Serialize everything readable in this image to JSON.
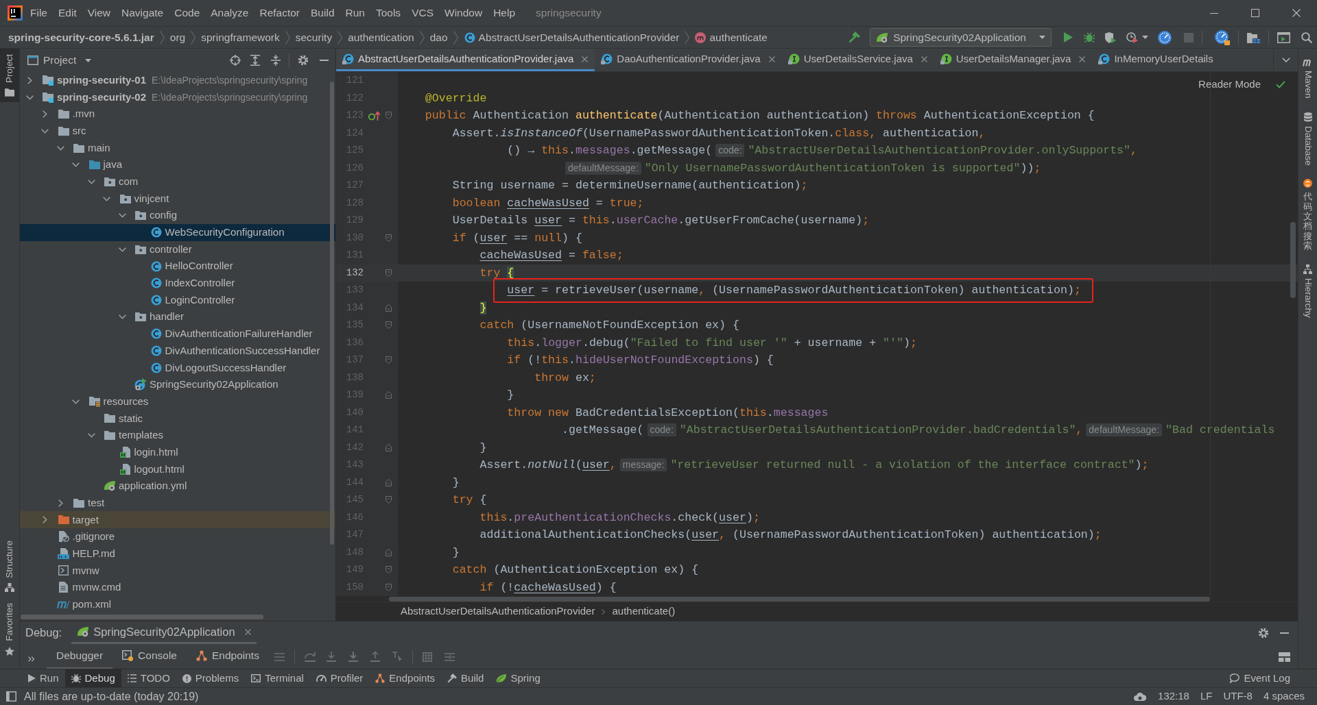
{
  "title_bar": {
    "menus": [
      "File",
      "Edit",
      "View",
      "Navigate",
      "Code",
      "Analyze",
      "Refactor",
      "Build",
      "Run",
      "Tools",
      "VCS",
      "Window",
      "Help"
    ],
    "title": "springsecurity"
  },
  "nav_bar": {
    "breadcrumbs": [
      {
        "label": "spring-security-core-5.6.1.jar",
        "kind": "jar"
      },
      {
        "label": "org",
        "kind": "package"
      },
      {
        "label": "springframework",
        "kind": "package"
      },
      {
        "label": "security",
        "kind": "package"
      },
      {
        "label": "authentication",
        "kind": "package"
      },
      {
        "label": "dao",
        "kind": "package"
      },
      {
        "label": "AbstractUserDetailsAuthenticationProvider",
        "kind": "class"
      },
      {
        "label": "authenticate",
        "kind": "method"
      }
    ],
    "run_configuration": "SpringSecurity02Application"
  },
  "left_strip": {
    "top": [
      {
        "label": "Project",
        "kind": "project",
        "selected": true
      }
    ],
    "bottom": [
      {
        "label": "Structure",
        "kind": "structure",
        "selected": false
      },
      {
        "label": "Favorites",
        "kind": "favorites",
        "selected": false
      }
    ]
  },
  "project_panel": {
    "title": "Project",
    "tree": [
      {
        "label": "spring-security-01",
        "path": "E:\\IdeaProjects\\springsecurity\\spring",
        "kind": "module",
        "expanded": false,
        "selected": false
      },
      {
        "label": "spring-security-02",
        "path": "E:\\IdeaProjects\\springsecurity\\spring",
        "kind": "module",
        "expanded": true,
        "selected": false,
        "children": [
          {
            "label": ".mvn",
            "kind": "folder",
            "expanded": false,
            "selected": false
          },
          {
            "label": "src",
            "kind": "folder",
            "expanded": true,
            "selected": false,
            "children": [
              {
                "label": "main",
                "kind": "folder",
                "expanded": true,
                "selected": false,
                "children": [
                  {
                    "label": "java",
                    "kind": "source_folder",
                    "expanded": true,
                    "selected": false,
                    "children": [
                      {
                        "label": "com",
                        "kind": "package",
                        "expanded": true,
                        "selected": false,
                        "children": [
                          {
                            "label": "vinjcent",
                            "kind": "package",
                            "expanded": true,
                            "selected": false,
                            "children": [
                              {
                                "label": "config",
                                "kind": "package",
                                "expanded": true,
                                "selected": false,
                                "children": [
                                  {
                                    "label": "WebSecurityConfiguration",
                                    "kind": "class",
                                    "selected": true
                                  }
                                ]
                              },
                              {
                                "label": "controller",
                                "kind": "package",
                                "expanded": true,
                                "selected": false,
                                "children": [
                                  {
                                    "label": "HelloController",
                                    "kind": "class",
                                    "selected": false
                                  },
                                  {
                                    "label": "IndexController",
                                    "kind": "class",
                                    "selected": false
                                  },
                                  {
                                    "label": "LoginController",
                                    "kind": "class",
                                    "selected": false
                                  }
                                ]
                              },
                              {
                                "label": "handler",
                                "kind": "package",
                                "expanded": true,
                                "selected": false,
                                "children": [
                                  {
                                    "label": "DivAuthenticationFailureHandler",
                                    "kind": "class",
                                    "selected": false
                                  },
                                  {
                                    "label": "DivAuthenticationSuccessHandler",
                                    "kind": "class",
                                    "selected": false
                                  },
                                  {
                                    "label": "DivLogoutSuccessHandler",
                                    "kind": "class",
                                    "selected": false
                                  }
                                ]
                              },
                              {
                                "label": "SpringSecurity02Application",
                                "kind": "boot_class",
                                "selected": false
                              }
                            ]
                          }
                        ]
                      }
                    ]
                  },
                  {
                    "label": "resources",
                    "kind": "resources_folder",
                    "expanded": true,
                    "selected": false,
                    "children": [
                      {
                        "label": "static",
                        "kind": "folder",
                        "selected": false
                      },
                      {
                        "label": "templates",
                        "kind": "folder",
                        "expanded": true,
                        "selected": false,
                        "children": [
                          {
                            "label": "login.html",
                            "kind": "html",
                            "selected": false
                          },
                          {
                            "label": "logout.html",
                            "kind": "html",
                            "selected": false
                          }
                        ]
                      },
                      {
                        "label": "application.yml",
                        "kind": "yaml",
                        "selected": false
                      }
                    ]
                  }
                ]
              },
              {
                "label": "test",
                "kind": "folder",
                "expanded": false,
                "selected": false
              }
            ]
          },
          {
            "label": "target",
            "kind": "excluded_folder",
            "expanded": false,
            "selected": false
          },
          {
            "label": ".gitignore",
            "kind": "ignore_file",
            "selected": false
          },
          {
            "label": "HELP.md",
            "kind": "markdown",
            "selected": false
          },
          {
            "label": "mvnw",
            "kind": "script",
            "selected": false
          },
          {
            "label": "mvnw.cmd",
            "kind": "text_file",
            "selected": false
          },
          {
            "label": "pom.xml",
            "kind": "maven",
            "selected": false
          }
        ]
      }
    ]
  },
  "editor": {
    "tabs": [
      {
        "label": "AbstractUserDetailsAuthenticationProvider.java",
        "kind": "class",
        "selected": true,
        "closable": true
      },
      {
        "label": "DaoAuthenticationProvider.java",
        "kind": "class",
        "selected": false,
        "closable": true
      },
      {
        "label": "UserDetailsService.java",
        "kind": "interface",
        "selected": false,
        "closable": true
      },
      {
        "label": "UserDetailsManager.java",
        "kind": "interface",
        "selected": false,
        "closable": true
      },
      {
        "label": "InMemoryUserDetails",
        "kind": "class",
        "selected": false,
        "closable": false
      }
    ],
    "reader_mode": "Reader Mode",
    "lines": [
      {
        "number": "121",
        "current": false,
        "boxed": false,
        "overrides": false,
        "fold_open": false,
        "fold_close": false
      },
      {
        "number": "122",
        "current": false,
        "boxed": false,
        "overrides": false,
        "fold_open": false,
        "fold_close": false,
        "tokens": [
          {
            "kind": "annotation",
            "text": "    @Override"
          }
        ]
      },
      {
        "number": "123",
        "current": false,
        "boxed": false,
        "overrides": true,
        "fold_open": true,
        "fold_close": false,
        "tokens": [
          {
            "kind": "keyword",
            "text": "    public "
          },
          {
            "kind": "plain",
            "text": "Authentication "
          },
          {
            "kind": "declaration",
            "text": "authenticate"
          },
          {
            "kind": "plain",
            "text": "(Authentication authentication) "
          },
          {
            "kind": "keyword",
            "text": "throws "
          },
          {
            "kind": "plain",
            "text": "AuthenticationException {"
          }
        ]
      },
      {
        "number": "124",
        "current": false,
        "boxed": false,
        "overrides": false,
        "fold_open": false,
        "fold_close": false,
        "tokens": [
          {
            "kind": "plain",
            "text": "        Assert."
          },
          {
            "kind": "static",
            "text": "isInstanceOf"
          },
          {
            "kind": "plain",
            "text": "(UsernamePasswordAuthenticationToken."
          },
          {
            "kind": "keyword",
            "text": "class,"
          },
          {
            "kind": "plain",
            "text": " authentication"
          },
          {
            "kind": "keyword",
            "text": ","
          }
        ]
      },
      {
        "number": "125",
        "current": false,
        "boxed": false,
        "overrides": false,
        "fold_open": false,
        "fold_close": false,
        "tokens": [
          {
            "kind": "plain",
            "text": "                () → "
          },
          {
            "kind": "keyword",
            "text": "this"
          },
          {
            "kind": "plain",
            "text": "."
          },
          {
            "kind": "field",
            "text": "messages"
          },
          {
            "kind": "plain",
            "text": ".getMessage("
          },
          {
            "kind": "hint",
            "text": "code:"
          },
          {
            "kind": "string",
            "text": "\"AbstractUserDetailsAuthenticationProvider.onlySupports\""
          },
          {
            "kind": "keyword",
            "text": ","
          }
        ]
      },
      {
        "number": "126",
        "current": false,
        "boxed": false,
        "overrides": false,
        "fold_open": false,
        "fold_close": false,
        "tokens": [
          {
            "kind": "hint",
            "text": "                        defaultMessage:"
          },
          {
            "kind": "string",
            "text": "\"Only UsernamePasswordAuthenticationToken is supported\""
          },
          {
            "kind": "plain",
            "text": "))"
          },
          {
            "kind": "keyword",
            "text": ";"
          }
        ]
      },
      {
        "number": "127",
        "current": false,
        "boxed": false,
        "overrides": false,
        "fold_open": false,
        "fold_close": false,
        "tokens": [
          {
            "kind": "plain",
            "text": "        String username = determineUsername(authentication)"
          },
          {
            "kind": "keyword",
            "text": ";"
          }
        ]
      },
      {
        "number": "128",
        "current": false,
        "boxed": false,
        "overrides": false,
        "fold_open": false,
        "fold_close": false,
        "tokens": [
          {
            "kind": "keyword",
            "text": "        boolean "
          },
          {
            "kind": "reassigned",
            "text": "cacheWasUsed"
          },
          {
            "kind": "plain",
            "text": " = "
          },
          {
            "kind": "keyword",
            "text": "true;"
          }
        ]
      },
      {
        "number": "129",
        "current": false,
        "boxed": false,
        "overrides": false,
        "fold_open": false,
        "fold_close": false,
        "tokens": [
          {
            "kind": "plain",
            "text": "        UserDetails "
          },
          {
            "kind": "reassigned",
            "text": "user"
          },
          {
            "kind": "plain",
            "text": " = "
          },
          {
            "kind": "keyword",
            "text": "this"
          },
          {
            "kind": "plain",
            "text": "."
          },
          {
            "kind": "field",
            "text": "userCache"
          },
          {
            "kind": "plain",
            "text": ".getUserFromCache(username)"
          },
          {
            "kind": "keyword",
            "text": ";"
          }
        ]
      },
      {
        "number": "130",
        "current": false,
        "boxed": false,
        "overrides": false,
        "fold_open": true,
        "fold_close": false,
        "tokens": [
          {
            "kind": "keyword",
            "text": "        if "
          },
          {
            "kind": "plain",
            "text": "("
          },
          {
            "kind": "reassigned",
            "text": "user"
          },
          {
            "kind": "plain",
            "text": " == "
          },
          {
            "kind": "keyword",
            "text": "null"
          },
          {
            "kind": "plain",
            "text": ") {"
          }
        ]
      },
      {
        "number": "131",
        "current": false,
        "boxed": false,
        "overrides": false,
        "fold_open": false,
        "fold_close": false,
        "tokens": [
          {
            "kind": "reassigned",
            "text": "            cacheWasUsed"
          },
          {
            "kind": "plain",
            "text": " = "
          },
          {
            "kind": "keyword",
            "text": "false;"
          }
        ]
      },
      {
        "number": "132",
        "current": true,
        "boxed": false,
        "overrides": false,
        "fold_open": true,
        "fold_close": false,
        "tokens": [
          {
            "kind": "keyword",
            "text": "            try "
          },
          {
            "kind": "brace",
            "text": "{"
          }
        ]
      },
      {
        "number": "133",
        "current": false,
        "boxed": true,
        "overrides": false,
        "fold_open": false,
        "fold_close": false,
        "tokens": [
          {
            "kind": "reassigned",
            "text": "                user"
          },
          {
            "kind": "plain",
            "text": " = retrieveUser(username"
          },
          {
            "kind": "keyword",
            "text": ","
          },
          {
            "kind": "plain",
            "text": " (UsernamePasswordAuthenticationToken) authentication)"
          },
          {
            "kind": "keyword",
            "text": ";"
          }
        ]
      },
      {
        "number": "134",
        "current": false,
        "boxed": false,
        "overrides": false,
        "fold_open": false,
        "fold_close": true,
        "tokens": [
          {
            "kind": "brace",
            "text": "            }"
          }
        ]
      },
      {
        "number": "135",
        "current": false,
        "boxed": false,
        "overrides": false,
        "fold_open": true,
        "fold_close": false,
        "tokens": [
          {
            "kind": "keyword",
            "text": "            catch "
          },
          {
            "kind": "plain",
            "text": "(UsernameNotFoundException ex) {"
          }
        ]
      },
      {
        "number": "136",
        "current": false,
        "boxed": false,
        "overrides": false,
        "fold_open": false,
        "fold_close": false,
        "tokens": [
          {
            "kind": "keyword",
            "text": "                this"
          },
          {
            "kind": "plain",
            "text": "."
          },
          {
            "kind": "field",
            "text": "logger"
          },
          {
            "kind": "plain",
            "text": ".debug("
          },
          {
            "kind": "string",
            "text": "\"Failed to find user '\""
          },
          {
            "kind": "plain",
            "text": " + username + "
          },
          {
            "kind": "string",
            "text": "\"'\""
          },
          {
            "kind": "plain",
            "text": ")"
          },
          {
            "kind": "keyword",
            "text": ";"
          }
        ]
      },
      {
        "number": "137",
        "current": false,
        "boxed": false,
        "overrides": false,
        "fold_open": true,
        "fold_close": false,
        "tokens": [
          {
            "kind": "keyword",
            "text": "                if "
          },
          {
            "kind": "plain",
            "text": "(!"
          },
          {
            "kind": "keyword",
            "text": "this"
          },
          {
            "kind": "plain",
            "text": "."
          },
          {
            "kind": "field",
            "text": "hideUserNotFoundExceptions"
          },
          {
            "kind": "plain",
            "text": ") {"
          }
        ]
      },
      {
        "number": "138",
        "current": false,
        "boxed": false,
        "overrides": false,
        "fold_open": false,
        "fold_close": false,
        "tokens": [
          {
            "kind": "keyword",
            "text": "                    throw "
          },
          {
            "kind": "plain",
            "text": "ex"
          },
          {
            "kind": "keyword",
            "text": ";"
          }
        ]
      },
      {
        "number": "139",
        "current": false,
        "boxed": false,
        "overrides": false,
        "fold_open": false,
        "fold_close": true,
        "tokens": [
          {
            "kind": "plain",
            "text": "                }"
          }
        ]
      },
      {
        "number": "140",
        "current": false,
        "boxed": false,
        "overrides": false,
        "fold_open": false,
        "fold_close": false,
        "tokens": [
          {
            "kind": "keyword",
            "text": "                throw new "
          },
          {
            "kind": "plain",
            "text": "BadCredentialsException("
          },
          {
            "kind": "keyword",
            "text": "this"
          },
          {
            "kind": "plain",
            "text": "."
          },
          {
            "kind": "field",
            "text": "messages"
          }
        ]
      },
      {
        "number": "141",
        "current": false,
        "boxed": false,
        "overrides": false,
        "fold_open": false,
        "fold_close": false,
        "tokens": [
          {
            "kind": "plain",
            "text": "                        .getMessage("
          },
          {
            "kind": "hint",
            "text": "code:"
          },
          {
            "kind": "string",
            "text": "\"AbstractUserDetailsAuthenticationProvider.badCredentials\""
          },
          {
            "kind": "keyword",
            "text": ","
          },
          {
            "kind": "hint",
            "text": "defaultMessage:"
          },
          {
            "kind": "string",
            "text": "\"Bad credentials"
          }
        ]
      },
      {
        "number": "142",
        "current": false,
        "boxed": false,
        "overrides": false,
        "fold_open": false,
        "fold_close": true,
        "tokens": [
          {
            "kind": "plain",
            "text": "            }"
          }
        ]
      },
      {
        "number": "143",
        "current": false,
        "boxed": false,
        "overrides": false,
        "fold_open": false,
        "fold_close": false,
        "tokens": [
          {
            "kind": "plain",
            "text": "            Assert."
          },
          {
            "kind": "static",
            "text": "notNull"
          },
          {
            "kind": "plain",
            "text": "("
          },
          {
            "kind": "reassigned",
            "text": "user"
          },
          {
            "kind": "keyword",
            "text": ","
          },
          {
            "kind": "hint",
            "text": "message:"
          },
          {
            "kind": "string",
            "text": "\"retrieveUser returned null - a violation of the interface contract\""
          },
          {
            "kind": "plain",
            "text": ")"
          },
          {
            "kind": "keyword",
            "text": ";"
          }
        ]
      },
      {
        "number": "144",
        "current": false,
        "boxed": false,
        "overrides": false,
        "fold_open": false,
        "fold_close": true,
        "tokens": [
          {
            "kind": "plain",
            "text": "        }"
          }
        ]
      },
      {
        "number": "145",
        "current": false,
        "boxed": false,
        "overrides": false,
        "fold_open": true,
        "fold_close": false,
        "tokens": [
          {
            "kind": "keyword",
            "text": "        try "
          },
          {
            "kind": "plain",
            "text": "{"
          }
        ]
      },
      {
        "number": "146",
        "current": false,
        "boxed": false,
        "overrides": false,
        "fold_open": false,
        "fold_close": false,
        "tokens": [
          {
            "kind": "keyword",
            "text": "            this"
          },
          {
            "kind": "plain",
            "text": "."
          },
          {
            "kind": "field",
            "text": "preAuthenticationChecks"
          },
          {
            "kind": "plain",
            "text": ".check("
          },
          {
            "kind": "reassigned",
            "text": "user"
          },
          {
            "kind": "plain",
            "text": ")"
          },
          {
            "kind": "keyword",
            "text": ";"
          }
        ]
      },
      {
        "number": "147",
        "current": false,
        "boxed": false,
        "overrides": false,
        "fold_open": false,
        "fold_close": false,
        "tokens": [
          {
            "kind": "plain",
            "text": "            additionalAuthenticationChecks("
          },
          {
            "kind": "reassigned",
            "text": "user"
          },
          {
            "kind": "keyword",
            "text": ","
          },
          {
            "kind": "plain",
            "text": " (UsernamePasswordAuthenticationToken) authentication)"
          },
          {
            "kind": "keyword",
            "text": ";"
          }
        ]
      },
      {
        "number": "148",
        "current": false,
        "boxed": false,
        "overrides": false,
        "fold_open": false,
        "fold_close": true,
        "tokens": [
          {
            "kind": "plain",
            "text": "        }"
          }
        ]
      },
      {
        "number": "149",
        "current": false,
        "boxed": false,
        "overrides": false,
        "fold_open": true,
        "fold_close": false,
        "tokens": [
          {
            "kind": "keyword",
            "text": "        catch "
          },
          {
            "kind": "plain",
            "text": "(AuthenticationException ex) {"
          }
        ]
      },
      {
        "number": "150",
        "current": false,
        "boxed": false,
        "overrides": false,
        "fold_open": true,
        "fold_close": false,
        "tokens": [
          {
            "kind": "keyword",
            "text": "            if "
          },
          {
            "kind": "plain",
            "text": "(!"
          },
          {
            "kind": "reassigned",
            "text": "cacheWasUsed"
          },
          {
            "kind": "plain",
            "text": ") {"
          }
        ]
      }
    ],
    "breadcrumbs": [
      "AbstractUserDetailsAuthenticationProvider",
      "authenticate()"
    ]
  },
  "right_strip": {
    "top": [
      {
        "label": "Maven",
        "kind": "maven"
      },
      {
        "label": "Database",
        "kind": "database"
      },
      {
        "label": "代码文档搜索",
        "kind": "plugin"
      },
      {
        "label": "Hierarchy",
        "kind": "hierarchy"
      }
    ]
  },
  "debug_panel": {
    "title": "Debug:",
    "session": "SpringSecurity02Application",
    "tabs": [
      {
        "label": "Debugger",
        "kind": "debugger",
        "selected": true
      },
      {
        "label": "Console",
        "kind": "console",
        "selected": false
      },
      {
        "label": "Endpoints",
        "kind": "endpoints",
        "selected": false
      }
    ]
  },
  "tool_window_bar": {
    "left": [
      {
        "label": "Run",
        "kind": "run",
        "selected": false
      },
      {
        "label": "Debug",
        "kind": "debug",
        "selected": true
      },
      {
        "label": "TODO",
        "kind": "todo",
        "selected": false
      },
      {
        "label": "Problems",
        "kind": "problems",
        "selected": false
      },
      {
        "label": "Terminal",
        "kind": "terminal",
        "selected": false
      },
      {
        "label": "Profiler",
        "kind": "profiler",
        "selected": false
      },
      {
        "label": "Endpoints",
        "kind": "endpoints",
        "selected": false
      },
      {
        "label": "Build",
        "kind": "build",
        "selected": false
      },
      {
        "label": "Spring",
        "kind": "spring",
        "selected": false
      }
    ],
    "right": [
      {
        "label": "Event Log",
        "kind": "event_log",
        "selected": false
      }
    ]
  },
  "status_bar": {
    "message": "All files are up-to-date (today 20:19)",
    "caret": "132:18",
    "line_separator": "LF",
    "encoding": "UTF-8",
    "indent": "4 spaces"
  }
}
